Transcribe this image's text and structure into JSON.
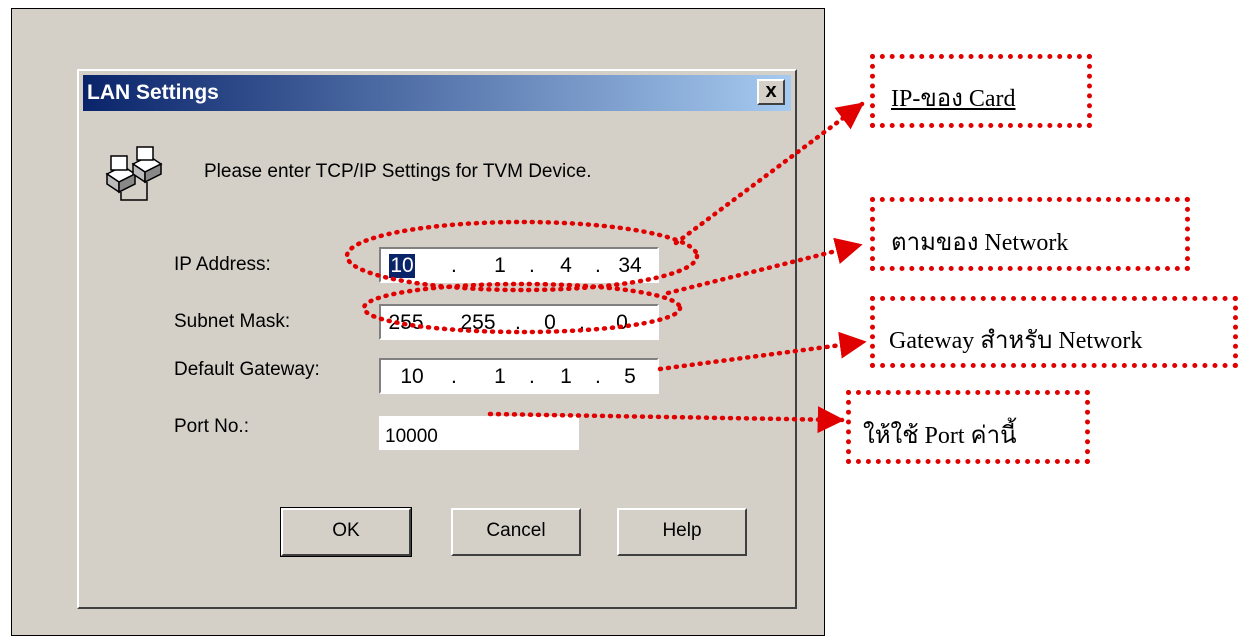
{
  "dialog": {
    "title": "LAN Settings",
    "close_symbol": "x",
    "icon": "network-computers-icon",
    "prompt": "Please enter TCP/IP Settings for TVM Device.",
    "ip_address": {
      "label": "IP Address:",
      "octets": [
        "10",
        "1",
        "4",
        "34"
      ]
    },
    "subnet_mask": {
      "label": "Subnet Mask:",
      "octets": [
        "255",
        "255",
        "0",
        "0"
      ]
    },
    "default_gateway": {
      "label": "Default Gateway:",
      "octets": [
        "10",
        "1",
        "1",
        "5"
      ]
    },
    "port": {
      "label": "Port No.:",
      "value": "10000"
    },
    "buttons": {
      "ok": "OK",
      "cancel": "Cancel",
      "help": "Help"
    }
  },
  "annotations": {
    "color": "#e00000",
    "ip_card": "IP-ของ Card",
    "network": "ตามของ Network",
    "gateway": "Gateway สำหรับ Network",
    "port": "ให้ใช้ Port ค่านี้"
  }
}
